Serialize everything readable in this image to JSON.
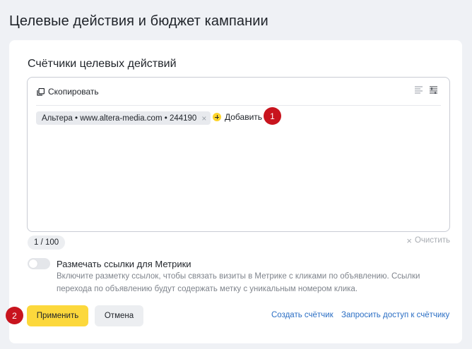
{
  "page": {
    "title": "Целевые действия и бюджет кампании"
  },
  "counters": {
    "section_title": "Счётчики целевых действий",
    "toolbar": {
      "copy_label": "Скопировать",
      "icons": [
        "copy-icon",
        "text-lines-icon",
        "list-settings-icon"
      ]
    },
    "chips": [
      {
        "label": "Альтера • www.altera-media.com • 244190"
      }
    ],
    "add_label": "Добавить",
    "count_label": "1 / 100",
    "clear_label": "Очистить"
  },
  "metrika_toggle": {
    "label": "Размечать ссылки для Метрики",
    "enabled": false,
    "hint": "Включите разметку ссылок, чтобы связать визиты в Метрике с кликами по объявлению. Ссылки перехода по объявлению будут содержать метку с уникальным номером клика."
  },
  "actions": {
    "apply_label": "Применить",
    "cancel_label": "Отмена",
    "create_counter_label": "Создать счётчик",
    "request_access_label": "Запросить доступ к счётчику"
  },
  "annotations": {
    "marker_1": "1",
    "marker_2": "2"
  },
  "colors": {
    "accent_yellow": "#fcd83c",
    "link_blue": "#2a6ec4",
    "marker_red": "#c8141e",
    "background": "#eff1f5"
  }
}
